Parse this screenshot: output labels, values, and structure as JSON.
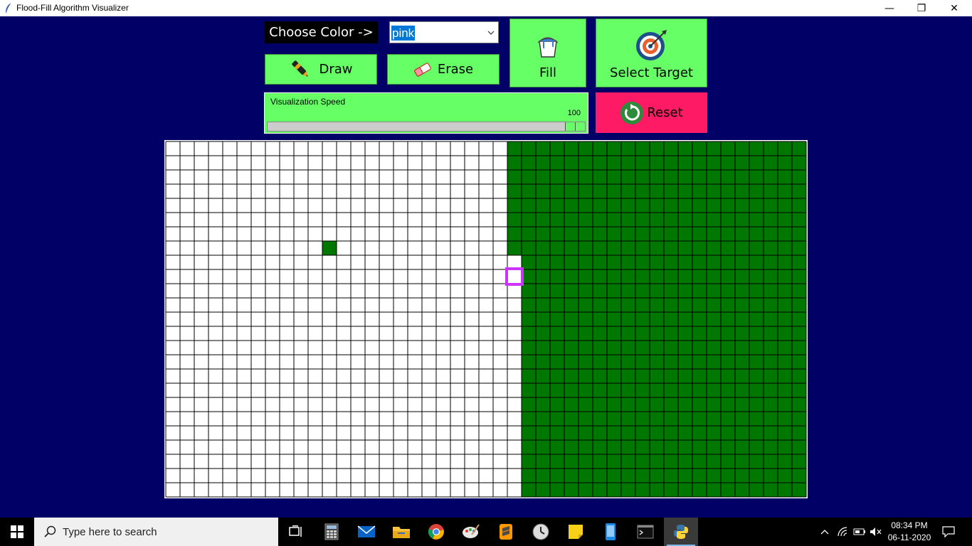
{
  "window": {
    "title": "Flood-Fill Algorithm Visualizer",
    "minimize_glyph": "—",
    "maximize_glyph": "❐",
    "close_glyph": "✕"
  },
  "controls": {
    "choose_color_label": "Choose Color ->",
    "color_select_value": "pink",
    "draw_label": "Draw",
    "erase_label": "Erase",
    "fill_label": "Fill",
    "select_target_label": "Select Target",
    "reset_label": "Reset",
    "speed_label": "Visualization Speed",
    "speed_value": "100",
    "speed_fraction": 1.0
  },
  "grid": {
    "columns": 45,
    "rows": 25,
    "background_color": "#ffffff",
    "fill_color": "#007700",
    "line_color": "#000000",
    "target_color": "#cc33ff",
    "filled_from_column_rows_0_to_7": 24,
    "filled_from_column_rows_8_to_24": 25,
    "single_filled_cell": {
      "row": 7,
      "col": 11
    },
    "target_cell": {
      "row": 9,
      "col": 24
    }
  },
  "taskbar": {
    "search_placeholder": "Type here to search",
    "time": "08:34 PM",
    "date": "06-11-2020",
    "apps": [
      "task-view-icon",
      "calculator-icon",
      "mail-icon",
      "file-explorer-icon",
      "chrome-icon",
      "paint-icon",
      "sublime-text-icon",
      "clock-icon",
      "sticky-notes-icon",
      "phone-icon",
      "terminal-icon",
      "python-icon"
    ]
  },
  "colors": {
    "background": "#000066",
    "button_green": "#66ff66",
    "reset_pink": "#ff1a66"
  }
}
